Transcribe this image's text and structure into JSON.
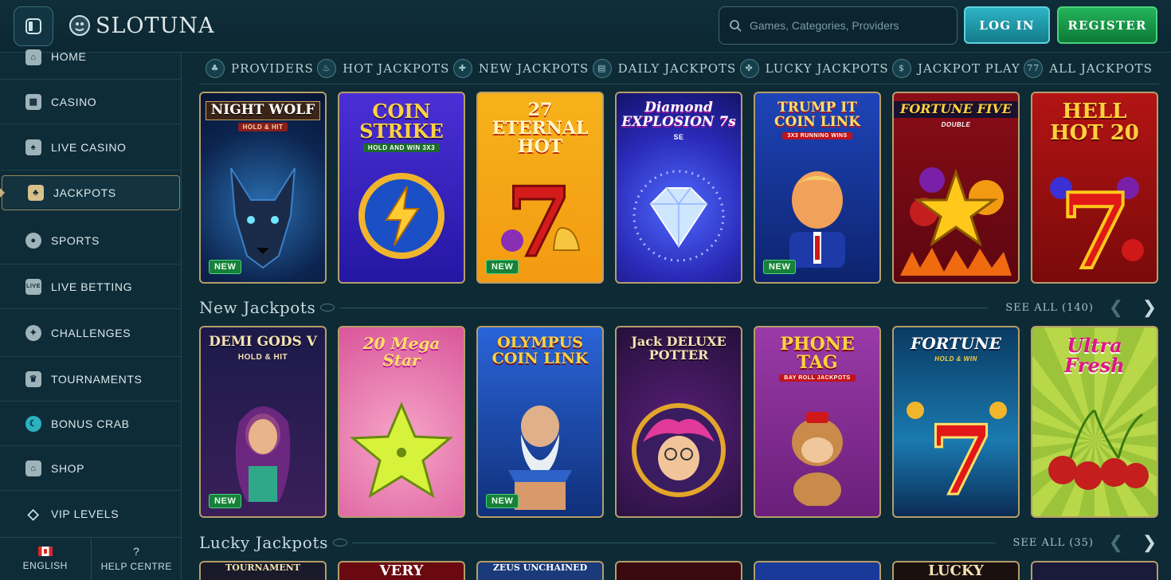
{
  "header": {
    "logo_text": "SLOTUNA",
    "search_placeholder": "Games, Categories, Providers",
    "login_label": "LOG IN",
    "register_label": "REGISTER"
  },
  "sidebar": {
    "items": [
      {
        "label": "HOME",
        "icon": "home-icon"
      },
      {
        "label": "CASINO",
        "icon": "casino-icon"
      },
      {
        "label": "LIVE CASINO",
        "icon": "live-casino-icon"
      },
      {
        "label": "JACKPOTS",
        "icon": "jackpots-icon",
        "active": true
      },
      {
        "label": "SPORTS",
        "icon": "sports-icon"
      },
      {
        "label": "LIVE BETTING",
        "icon": "live-betting-icon"
      },
      {
        "label": "CHALLENGES",
        "icon": "challenges-icon"
      },
      {
        "label": "TOURNAMENTS",
        "icon": "tournaments-icon"
      },
      {
        "label": "BONUS CRAB",
        "icon": "bonus-crab-icon"
      },
      {
        "label": "SHOP",
        "icon": "shop-icon"
      },
      {
        "label": "VIP LEVELS",
        "icon": "vip-icon"
      }
    ],
    "footer": {
      "language": "ENGLISH",
      "help": "HELP CENTRE"
    }
  },
  "categories": [
    "PROVIDERS",
    "HOT JACKPOTS",
    "NEW JACKPOTS",
    "DAILY JACKPOTS",
    "LUCKY JACKPOTS",
    "JACKPOT PLAY",
    "ALL JACKPOTS"
  ],
  "rows": {
    "top": [
      {
        "title": "NIGHT WOLF",
        "sub": "HOLD & HIT",
        "badge": "NEW"
      },
      {
        "title": "COIN STRIKE",
        "sub": "HOLD AND WIN 3x3"
      },
      {
        "title": "27 ETERNAL HOT",
        "badge": "NEW"
      },
      {
        "title": "Diamond EXPLOSION 7s",
        "sub": "SE"
      },
      {
        "title": "TRUMP IT COIN LINK",
        "sub": "3X3 RUNNING WINS",
        "badge": "NEW"
      },
      {
        "title": "FORTUNE FIVE",
        "sub": "Double"
      },
      {
        "title": "HELL HOT 20"
      }
    ],
    "new_jackpots": [
      {
        "title": "DEMI GODS V",
        "sub": "HOLD & HIT",
        "badge": "NEW"
      },
      {
        "title": "20 Mega Star"
      },
      {
        "title": "OLYMPUS COIN LINK",
        "badge": "NEW"
      },
      {
        "title": "Jack DELUXE POTTER"
      },
      {
        "title": "PHONE TAG",
        "sub": "BAY ROLL JACKPOTS"
      },
      {
        "title": "FORTUNE",
        "sub": "HOLD & WIN"
      },
      {
        "title": "Ultra Fresh"
      }
    ],
    "lucky_peek": [
      "TOURNAMENT",
      "VERY",
      "ZEUS UNCHAINED",
      "",
      "",
      "LUCKY",
      ""
    ]
  },
  "sections": {
    "new": {
      "title": "New Jackpots",
      "see_all": "SEE ALL (140)"
    },
    "lucky": {
      "title": "Lucky Jackpots",
      "see_all": "SEE ALL (35)"
    }
  }
}
